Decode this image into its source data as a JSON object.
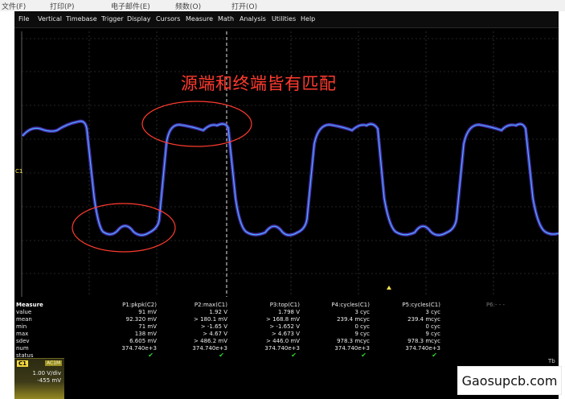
{
  "host_menu": [
    "文件(F)",
    "打印(P)",
    "电子邮件(E)",
    "频数(O)",
    "打开(O)"
  ],
  "scope_menu": [
    "File",
    "Vertical",
    "Timebase",
    "Trigger",
    "Display",
    "Cursors",
    "Measure",
    "Math",
    "Analysis",
    "Utilities",
    "Help"
  ],
  "annotation": "源端和终端皆有匹配",
  "channel_marker": "C1",
  "measure": {
    "row_labels": [
      "Measure",
      "value",
      "mean",
      "min",
      "max",
      "sdev",
      "num",
      "status"
    ],
    "columns": [
      {
        "header": "P1:pkpk(C2)",
        "values": [
          "91 mV",
          "92.320 mV",
          "71 mV",
          "138 mV",
          "6.605 mV",
          "374.740e+3"
        ],
        "status": "ok"
      },
      {
        "header": "P2:max(C1)",
        "values": [
          "1.92 V",
          "> 180.1 mV",
          "> -1.65 V",
          "> 4.67 V",
          "> 486.2 mV",
          "374.740e+3"
        ],
        "status": "ok"
      },
      {
        "header": "P3:top(C1)",
        "values": [
          "1.798 V",
          "> 168.8 mV",
          "> -1.652 V",
          "> 4.673 V",
          "> 446.0 mV",
          "374.740e+3"
        ],
        "status": "ok"
      },
      {
        "header": "P4:cycles(C1)",
        "values": [
          "3 cyc",
          "239.4 mcyc",
          "0 cyc",
          "9 cyc",
          "978.3 mcyc",
          "374.740e+3"
        ],
        "status": "ok"
      },
      {
        "header": "P5:cycles(C1)",
        "values": [
          "3 cyc",
          "239.4 mcyc",
          "0 cyc",
          "9 cyc",
          "978.3 mcyc",
          "374.740e+3"
        ],
        "status": "ok"
      },
      {
        "header": "P6:- - -",
        "values": [
          "",
          "",
          "",
          "",
          "",
          ""
        ],
        "status": ""
      }
    ]
  },
  "channel_box": {
    "tag": "C1",
    "act": "AC1M",
    "scale": "1.00 V/div",
    "offset": "-455 mV"
  },
  "tb_badge": "Tb",
  "watermark": "Gaosupcb.com",
  "colors": {
    "trace": "#36b6f0",
    "grid": "#3a3a3a",
    "annotation": "#ff3b2f",
    "c1": "#f5d940"
  }
}
